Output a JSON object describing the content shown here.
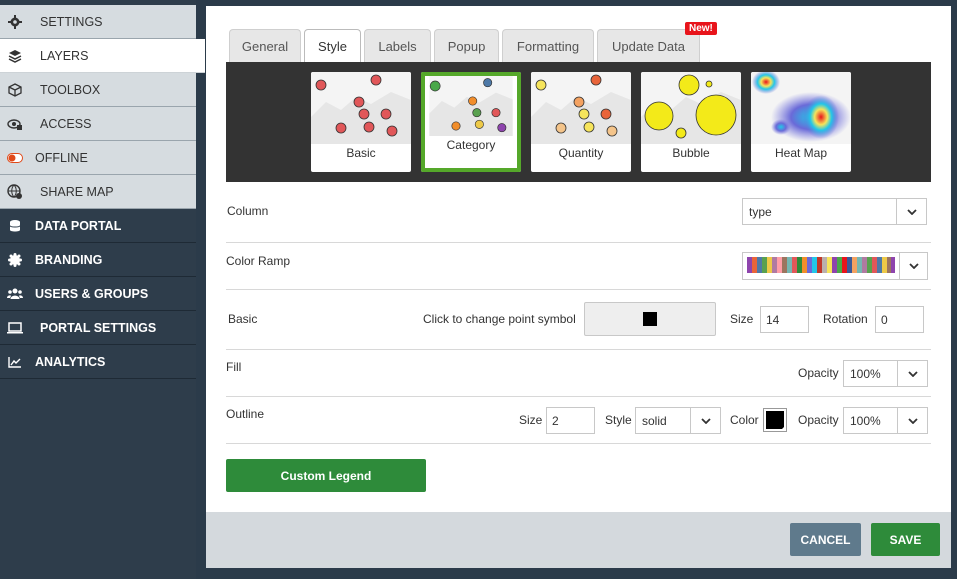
{
  "sidebar": {
    "items": [
      {
        "label": "SETTINGS",
        "icon": "gear-icon",
        "kind": "sub"
      },
      {
        "label": "LAYERS",
        "icon": "layers-icon",
        "kind": "active"
      },
      {
        "label": "TOOLBOX",
        "icon": "cube-icon",
        "kind": "sub"
      },
      {
        "label": "ACCESS",
        "icon": "eye-lock-icon",
        "kind": "sub"
      },
      {
        "label": "OFFLINE",
        "icon": "toggle-icon",
        "kind": "sub"
      },
      {
        "label": "SHARE MAP",
        "icon": "share-globe-icon",
        "kind": "sub"
      },
      {
        "label": "DATA PORTAL",
        "icon": "database-icon",
        "kind": "main"
      },
      {
        "label": "BRANDING",
        "icon": "badge-icon",
        "kind": "main"
      },
      {
        "label": "USERS & GROUPS",
        "icon": "users-icon",
        "kind": "main"
      },
      {
        "label": "PORTAL SETTINGS",
        "icon": "laptop-icon",
        "kind": "main"
      },
      {
        "label": "ANALYTICS",
        "icon": "chart-icon",
        "kind": "main"
      }
    ]
  },
  "tabs": [
    {
      "label": "General"
    },
    {
      "label": "Style"
    },
    {
      "label": "Labels"
    },
    {
      "label": "Popup"
    },
    {
      "label": "Formatting"
    },
    {
      "label": "Update Data"
    }
  ],
  "active_tab": "Style",
  "new_badge": "New!",
  "styles": [
    {
      "label": "Basic"
    },
    {
      "label": "Category"
    },
    {
      "label": "Quantity"
    },
    {
      "label": "Bubble"
    },
    {
      "label": "Heat Map"
    }
  ],
  "selected_style": "Category",
  "form": {
    "column": {
      "label": "Column",
      "value": "type"
    },
    "color_ramp": {
      "label": "Color Ramp"
    },
    "basic": {
      "label": "Basic",
      "symbol_hint": "Click to change point symbol",
      "size_label": "Size",
      "size_value": "14",
      "rotation_label": "Rotation",
      "rotation_value": "0"
    },
    "fill": {
      "label": "Fill",
      "opacity_label": "Opacity",
      "opacity_value": "100%"
    },
    "outline": {
      "label": "Outline",
      "size_label": "Size",
      "size_value": "2",
      "style_label": "Style",
      "style_value": "solid",
      "color_label": "Color",
      "color_value": "#000000",
      "opacity_label": "Opacity",
      "opacity_value": "100%"
    }
  },
  "buttons": {
    "custom_legend": "Custom Legend",
    "cancel": "CANCEL",
    "save": "SAVE"
  },
  "colors": {
    "accent_green": "#2e8b3a",
    "selected_border": "#55a82a",
    "cancel_gray": "#5f7a8c",
    "badge_red": "#e8141b",
    "sidebar_dark": "#2e3d4b"
  }
}
